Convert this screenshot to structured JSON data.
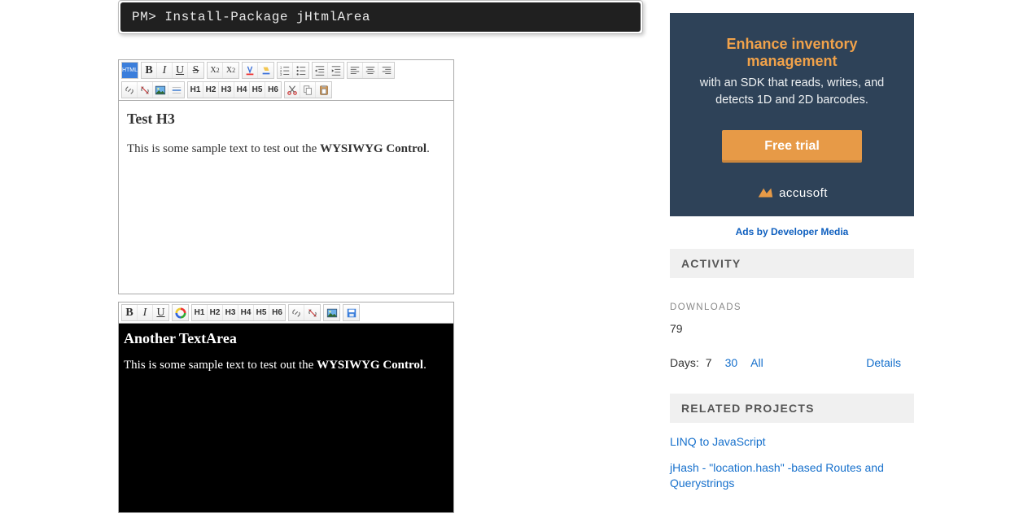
{
  "terminal": {
    "text": "PM> Install-Package jHtmlArea"
  },
  "editor1": {
    "heading": "Test H3",
    "body_pre": "This is some sample text to test out the ",
    "body_bold": "WYSIWYG Control",
    "body_post": "."
  },
  "editor2": {
    "heading": "Another TextArea",
    "body_pre": "This is some sample text to test out the ",
    "body_bold": "WYSIWYG Control",
    "body_post": "."
  },
  "toolbar": {
    "html": "HTML",
    "bold": "B",
    "italic": "I",
    "underline": "U",
    "strike": "S",
    "subscript": "X",
    "subscript_sub": "2",
    "superscript": "X",
    "superscript_sup": "2",
    "h1": "H1",
    "h2": "H2",
    "h3": "H3",
    "h4": "H4",
    "h5": "H5",
    "h6": "H6"
  },
  "ad": {
    "title": "Enhance inventory management",
    "body": "with an SDK that reads, writes, and detects 1D and 2D barcodes.",
    "button": "Free trial",
    "brand": "accusoft"
  },
  "ads_by": "Ads by Developer Media",
  "sidebar": {
    "activity_label": "ACTIVITY",
    "downloads_label": "DOWNLOADS",
    "downloads_value": "79",
    "days_label": "Days:",
    "days_current": "7",
    "days_30": "30",
    "days_all": "All",
    "details": "Details",
    "related_label": "RELATED PROJECTS",
    "related1": "LINQ to JavaScript",
    "related2": "jHash - \"location.hash\" -based Routes and Querystrings"
  }
}
